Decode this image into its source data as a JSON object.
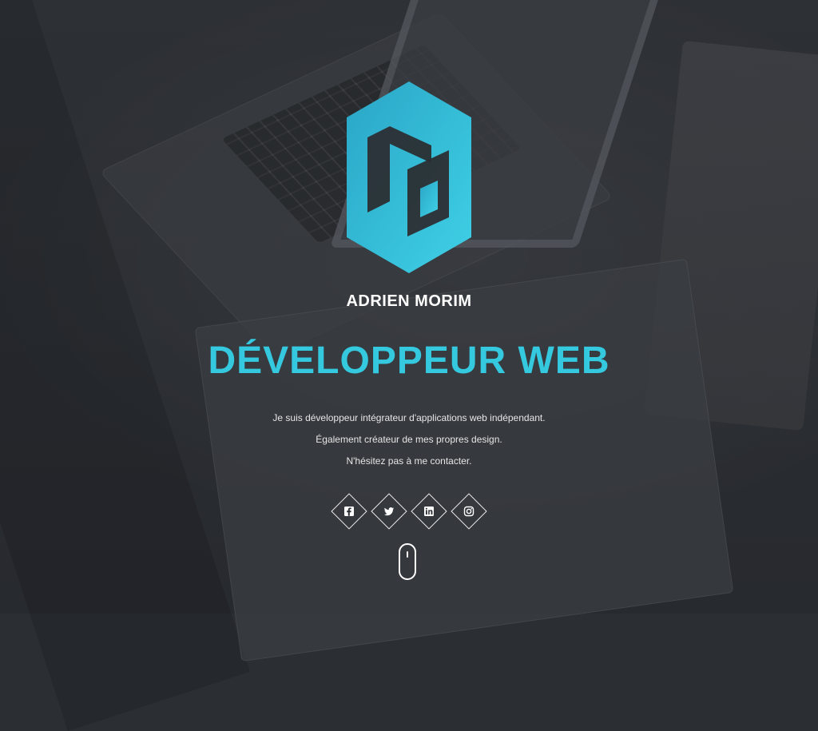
{
  "profile": {
    "name": "ADRIEN MORIM",
    "title": "DÉVELOPPEUR WEB"
  },
  "bio": {
    "lines": [
      "Je suis développeur intégrateur d'applications web indépendant.",
      "Également créateur de mes propres design.",
      "N'hésitez pas à me contacter."
    ]
  },
  "social": {
    "items": [
      {
        "name": "facebook",
        "icon": "facebook-icon"
      },
      {
        "name": "twitter",
        "icon": "twitter-icon"
      },
      {
        "name": "linkedin",
        "icon": "linkedin-icon"
      },
      {
        "name": "instagram",
        "icon": "instagram-icon"
      }
    ]
  },
  "colors": {
    "accent": "#35c9e0",
    "text": "#ffffff"
  }
}
